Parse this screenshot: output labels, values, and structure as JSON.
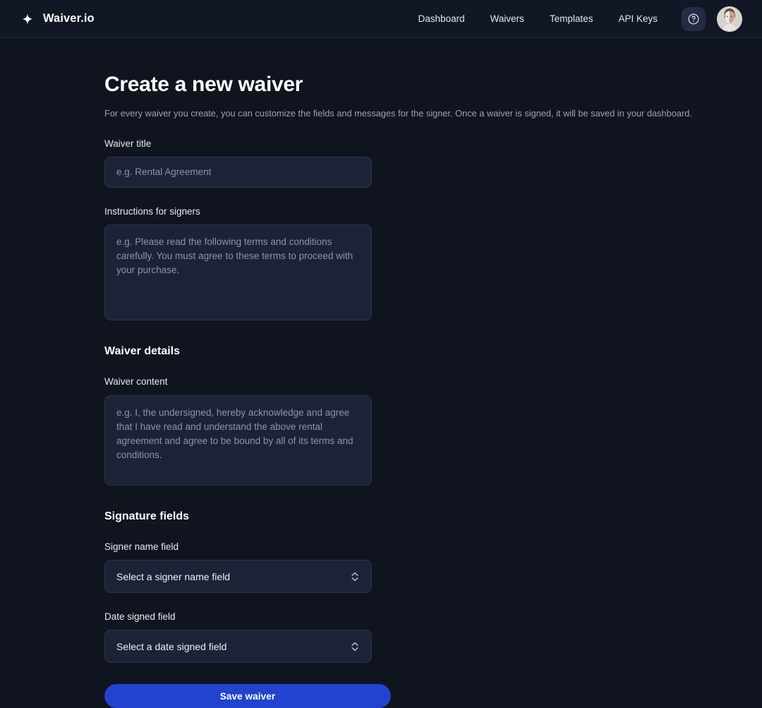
{
  "header": {
    "logo_icon": "sparkle-icon",
    "brand": "Waiver.io",
    "nav": [
      {
        "label": "Dashboard"
      },
      {
        "label": "Waivers"
      },
      {
        "label": "Templates"
      },
      {
        "label": "API Keys"
      }
    ],
    "help_icon": "question-mark-circle-icon",
    "avatar_alt": "User avatar"
  },
  "main": {
    "title": "Create a new waiver",
    "subtitle": "For every waiver you create, you can customize the fields and messages for the signer. Once a waiver is signed, it will be saved in your dashboard.",
    "waiver_title": {
      "label": "Waiver title",
      "value": "",
      "placeholder": "e.g. Rental Agreement"
    },
    "instructions": {
      "label": "Instructions for signers",
      "value": "",
      "placeholder": "e.g. Please read the following terms and conditions carefully. You must agree to these terms to proceed with your purchase."
    },
    "details_section": {
      "heading": "Waiver details",
      "content": {
        "label": "Waiver content",
        "value": "",
        "placeholder": "e.g. I, the undersigned, hereby acknowledge and agree that I have read and understand the above rental agreement and agree to be bound by all of its terms and conditions."
      }
    },
    "signature_section": {
      "heading": "Signature fields",
      "signer_name": {
        "label": "Signer name field",
        "selected": "Select a signer name field",
        "chevron_icon": "chevron-up-down-icon"
      },
      "date_signed": {
        "label": "Date signed field",
        "selected": "Select a date signed field",
        "chevron_icon": "chevron-up-down-icon"
      }
    },
    "save_button": "Save waiver"
  },
  "colors": {
    "page_bg": "#10141f",
    "header_bg": "#121726",
    "field_bg": "#1d2336",
    "field_border": "#2c3349",
    "accent": "#2243ce",
    "text_primary": "#ffffff",
    "text_muted": "#9aa2b8",
    "placeholder": "#8c93ab"
  }
}
